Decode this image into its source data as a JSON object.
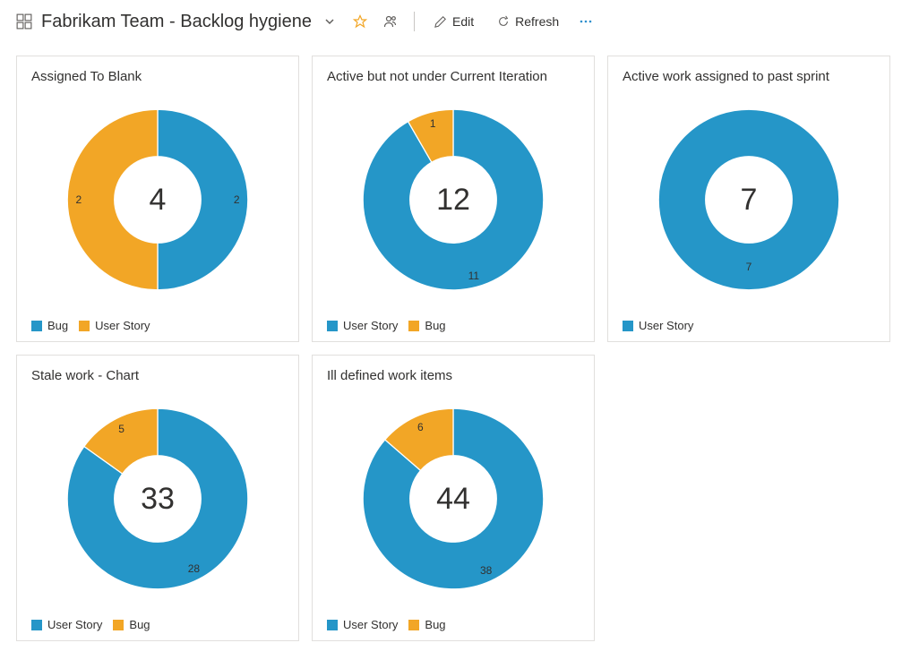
{
  "header": {
    "title": "Fabrikam Team - Backlog hygiene",
    "edit_label": "Edit",
    "refresh_label": "Refresh"
  },
  "palette": {
    "blue": "#2596c8",
    "orange": "#f2a626"
  },
  "chart_data": [
    {
      "title": "Assigned To Blank",
      "type": "pie",
      "total": 4,
      "series": [
        {
          "name": "Bug",
          "value": 2,
          "color": "#2596c8"
        },
        {
          "name": "User Story",
          "value": 2,
          "color": "#f2a626"
        }
      ]
    },
    {
      "title": "Active but not under Current Iteration",
      "type": "pie",
      "total": 12,
      "series": [
        {
          "name": "User Story",
          "value": 11,
          "color": "#2596c8"
        },
        {
          "name": "Bug",
          "value": 1,
          "color": "#f2a626"
        }
      ]
    },
    {
      "title": "Active work assigned to past sprint",
      "type": "pie",
      "total": 7,
      "series": [
        {
          "name": "User Story",
          "value": 7,
          "color": "#2596c8"
        }
      ]
    },
    {
      "title": "Stale work - Chart",
      "type": "pie",
      "total": 33,
      "series": [
        {
          "name": "User Story",
          "value": 28,
          "color": "#2596c8"
        },
        {
          "name": "Bug",
          "value": 5,
          "color": "#f2a626"
        }
      ]
    },
    {
      "title": "Ill defined work items",
      "type": "pie",
      "total": 44,
      "series": [
        {
          "name": "User Story",
          "value": 38,
          "color": "#2596c8"
        },
        {
          "name": "Bug",
          "value": 6,
          "color": "#f2a626"
        }
      ]
    }
  ]
}
